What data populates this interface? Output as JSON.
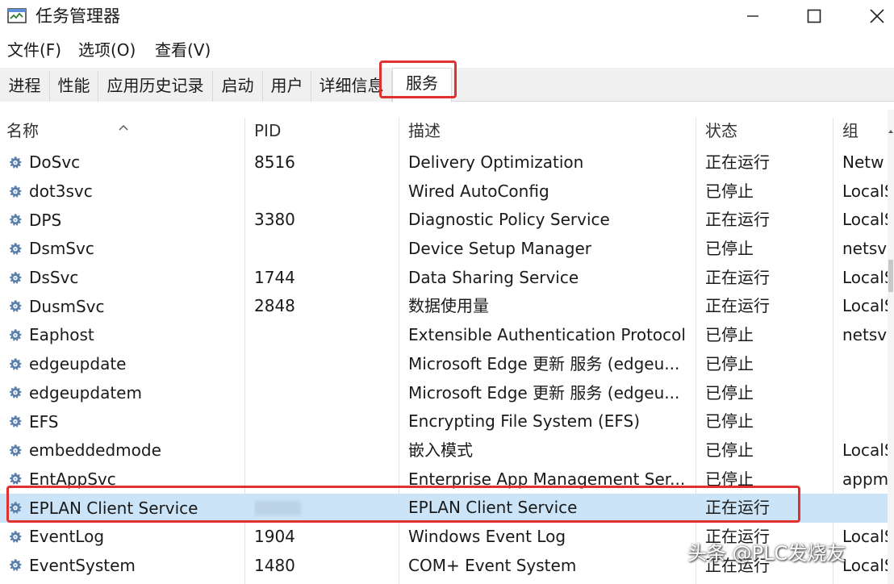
{
  "window": {
    "title": "任务管理器",
    "icon": "task-manager-icon"
  },
  "menu": [
    "文件(F)",
    "选项(O)",
    "查看(V)"
  ],
  "tabs": [
    {
      "label": "进程"
    },
    {
      "label": "性能"
    },
    {
      "label": "应用历史记录"
    },
    {
      "label": "启动"
    },
    {
      "label": "用户"
    },
    {
      "label": "详细信息"
    },
    {
      "label": "服务"
    }
  ],
  "active_tab": "服务",
  "columns": [
    "名称",
    "PID",
    "描述",
    "状态",
    "组"
  ],
  "services": [
    {
      "name": "DoSvc",
      "pid": "8516",
      "desc": "Delivery Optimization",
      "state": "正在运行",
      "group": "Netw"
    },
    {
      "name": "dot3svc",
      "pid": "",
      "desc": "Wired AutoConfig",
      "state": "已停止",
      "group": "LocalS"
    },
    {
      "name": "DPS",
      "pid": "3380",
      "desc": "Diagnostic Policy Service",
      "state": "正在运行",
      "group": "LocalS"
    },
    {
      "name": "DsmSvc",
      "pid": "",
      "desc": "Device Setup Manager",
      "state": "已停止",
      "group": "netsvc"
    },
    {
      "name": "DsSvc",
      "pid": "1744",
      "desc": "Data Sharing Service",
      "state": "正在运行",
      "group": "LocalS"
    },
    {
      "name": "DusmSvc",
      "pid": "2848",
      "desc": "数据使用量",
      "state": "正在运行",
      "group": "LocalS"
    },
    {
      "name": "Eaphost",
      "pid": "",
      "desc": "Extensible Authentication Protocol",
      "state": "已停止",
      "group": "netsvc"
    },
    {
      "name": "edgeupdate",
      "pid": "",
      "desc": "Microsoft Edge 更新 服务 (edgeu...",
      "state": "已停止",
      "group": ""
    },
    {
      "name": "edgeupdatem",
      "pid": "",
      "desc": "Microsoft Edge 更新 服务 (edgeu...",
      "state": "已停止",
      "group": ""
    },
    {
      "name": "EFS",
      "pid": "",
      "desc": "Encrypting File System (EFS)",
      "state": "已停止",
      "group": ""
    },
    {
      "name": "embeddedmode",
      "pid": "",
      "desc": "嵌入模式",
      "state": "已停止",
      "group": "LocalS"
    },
    {
      "name": "EntAppSvc",
      "pid": "",
      "desc": "Enterprise App Management Ser...",
      "state": "已停止",
      "group": "appm"
    },
    {
      "name": "EPLAN Client Service",
      "pid": "",
      "desc": "EPLAN Client Service",
      "state": "正在运行",
      "group": "",
      "selected": true
    },
    {
      "name": "EventLog",
      "pid": "1904",
      "desc": "Windows Event Log",
      "state": "正在运行",
      "group": "LocalS"
    },
    {
      "name": "EventSystem",
      "pid": "1480",
      "desc": "COM+ Event System",
      "state": "正在运行",
      "group": "LocalS"
    }
  ],
  "watermark": "头条 @PLC发烧友",
  "colors": {
    "highlight_box": "#e03131",
    "selected_row": "#cce4f7"
  }
}
